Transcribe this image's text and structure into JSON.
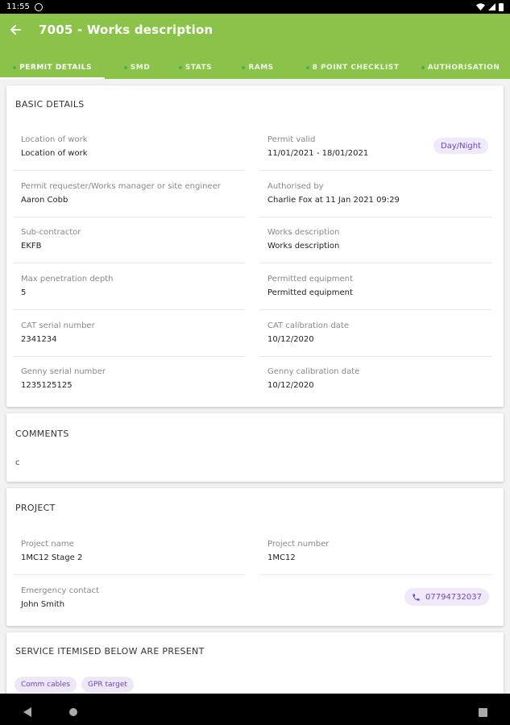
{
  "status_bar": {
    "time": "11:55"
  },
  "app_bar": {
    "title": "7005 - Works description",
    "tabs": [
      {
        "label": "PERMIT DETAILS",
        "active": true
      },
      {
        "label": "SMD",
        "active": false
      },
      {
        "label": "STATS",
        "active": false
      },
      {
        "label": "RAMS",
        "active": false
      },
      {
        "label": "8 POINT CHECKLIST",
        "active": false
      },
      {
        "label": "AUTHORISATION",
        "active": false
      }
    ]
  },
  "basic_details": {
    "title": "BASIC DETAILS",
    "badge": "Day/Night",
    "fields": [
      {
        "label": "Location of work",
        "value": "Location of work"
      },
      {
        "label": "Permit valid",
        "value": "11/01/2021 - 18/01/2021"
      },
      {
        "label": "Permit requester/Works manager or site engineer",
        "value": "Aaron Cobb"
      },
      {
        "label": "Authorised by",
        "value": "Charlie Fox at 11 Jan 2021 09:29"
      },
      {
        "label": "Sub-contractor",
        "value": "EKFB"
      },
      {
        "label": "Works description",
        "value": "Works description"
      },
      {
        "label": "Max penetration depth",
        "value": "5"
      },
      {
        "label": "Permitted equipment",
        "value": "Permitted equipment"
      },
      {
        "label": "CAT serial number",
        "value": "2341234"
      },
      {
        "label": "CAT calibration date",
        "value": "10/12/2020"
      },
      {
        "label": "Genny serial number",
        "value": "1235125125"
      },
      {
        "label": "Genny calibration date",
        "value": "10/12/2020"
      }
    ]
  },
  "comments": {
    "title": "COMMENTS",
    "text": "c"
  },
  "project": {
    "title": "PROJECT",
    "fields": [
      {
        "label": "Project name",
        "value": "1MC12 Stage 2"
      },
      {
        "label": "Project number",
        "value": "1MC12"
      },
      {
        "label": "Emergency contact",
        "value": "John Smith"
      }
    ],
    "phone": "07794732037"
  },
  "services": {
    "title": "SERVICE ITEMISED BELOW ARE PRESENT",
    "chips": [
      "Comm cables",
      "GPR target"
    ]
  },
  "colors": {
    "primary": "#8bc34a",
    "chip_bg": "#efe9fa",
    "chip_text": "#6a47c8"
  },
  "icons": {
    "back": "arrow-left-icon",
    "phone": "phone-icon"
  }
}
